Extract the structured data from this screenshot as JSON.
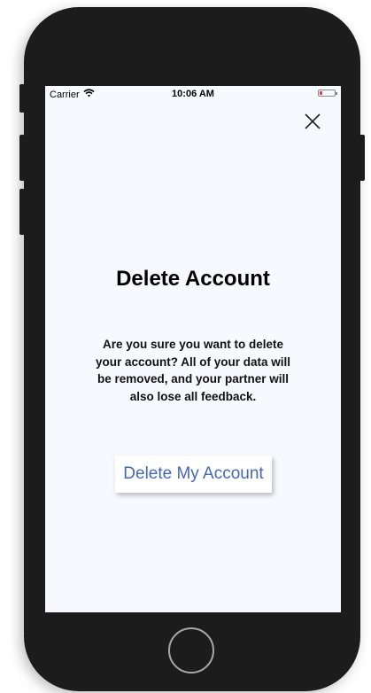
{
  "status_bar": {
    "carrier": "Carrier",
    "time": "10:06 AM",
    "battery_level": 0.2,
    "battery_color": "#e53935",
    "wifi_icon": "wifi-icon"
  },
  "dialog": {
    "close_icon": "close-icon",
    "title": "Delete Account",
    "message": "Are you sure you want to delete your account? All of your data will be removed, and your partner will also lose all feedback.",
    "delete_button_label": "Delete My Account"
  },
  "colors": {
    "screen_background": "#f8f9ff",
    "button_text": "#4766b3",
    "phone_body": "#1c1c1c"
  }
}
